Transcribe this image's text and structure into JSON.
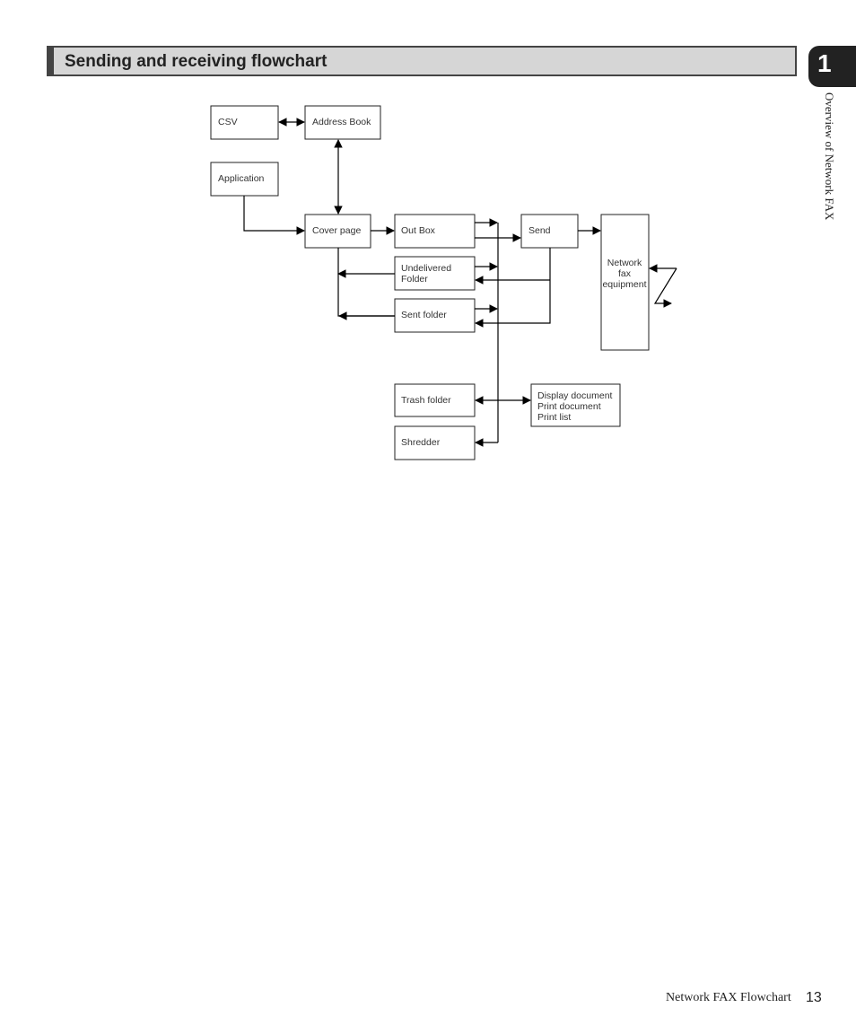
{
  "header": {
    "title": "Sending and receiving flowchart"
  },
  "chapter": {
    "number": "1",
    "side_label": "Overview of Network FAX"
  },
  "diagram": {
    "nodes": {
      "csv": "CSV",
      "address_book": "Address Book",
      "application": "Application",
      "cover_page": "Cover page",
      "out_box": "Out Box",
      "send": "Send",
      "undelivered_1": "Undelivered",
      "undelivered_2": "Folder",
      "sent_folder": "Sent folder",
      "network_1": "Network",
      "network_2": "fax",
      "network_3": "equipment",
      "trash_folder": "Trash folder",
      "shredder": "Shredder",
      "actions_1": "Display document",
      "actions_2": "Print document",
      "actions_3": "Print list"
    }
  },
  "footer": {
    "title": "Network FAX Flowchart",
    "page": "13"
  }
}
